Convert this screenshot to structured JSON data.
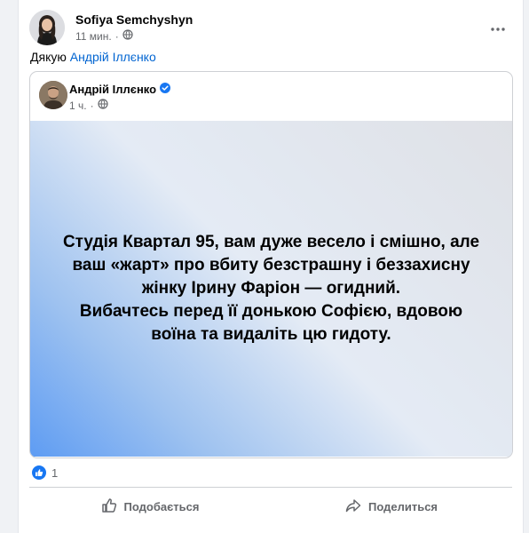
{
  "post": {
    "author": "Sofiya Semchyshyn",
    "time": "11 мин.",
    "text_prefix": "Дякую ",
    "mention": "Андрій Іллєнко"
  },
  "shared": {
    "author": "Андрій Іллєнко",
    "time": "1 ч.",
    "card_text": "Студія Квартал 95, вам дуже весело і смішно, але\nваш «жарт» про вбиту безстрашну і беззахисну\nжінку Ірину Фаріон — огидний.\nВибачтесь перед її донькою Софією, вдовою\nвоїна та видаліть цю гидоту."
  },
  "reactions": {
    "count": "1"
  },
  "actions": {
    "like_label": "Подобається",
    "share_label": "Поделиться"
  },
  "colors": {
    "accent": "#1877f2",
    "mention": "#0064d1",
    "muted": "#65676b"
  },
  "icons": {
    "globe": "globe-icon",
    "verified": "verified-badge-icon",
    "more": "more-options-icon",
    "like": "thumbs-up-icon",
    "share": "share-arrow-icon"
  }
}
